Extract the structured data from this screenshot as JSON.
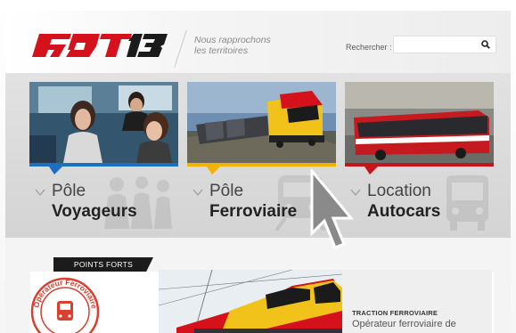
{
  "header": {
    "logo_text": "RDT 13",
    "tagline_line1": "Nous rapprochons",
    "tagline_line2": "les territoires",
    "search_label": "Rechercher :",
    "search_value": "",
    "search_icon": "search-icon"
  },
  "cards": [
    {
      "line1": "Pôle",
      "line2": "Voyageurs",
      "accent": "#1d6fc4"
    },
    {
      "line1": "Pôle",
      "line2": "Ferroviaire",
      "accent": "#f0b400"
    },
    {
      "line1": "Location",
      "line2": "Autocars",
      "accent": "#c5141b"
    }
  ],
  "lower": {
    "badge": "POINTS FORTS",
    "stamp_text": "Opérateur Ferroviaire",
    "traction_title": "TRACTION FERROVIAIRE",
    "traction_text": "Opérateur ferroviaire de"
  },
  "colors": {
    "brand_red": "#d5121b",
    "brand_black": "#1b1b1b"
  }
}
